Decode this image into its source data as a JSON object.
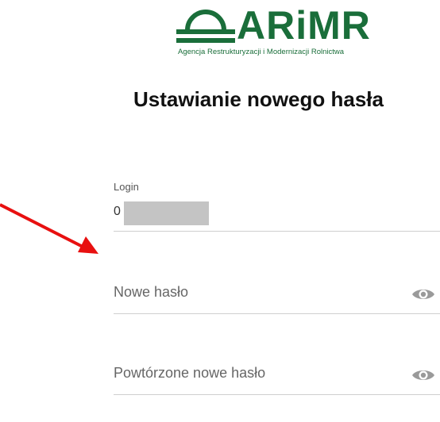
{
  "logo": {
    "name": "ARiMR",
    "subtitle": "Agencja Restrukturyzacji i Modernizacji Rolnictwa",
    "color": "#1a6e3a"
  },
  "page_title": "Ustawianie nowego hasła",
  "login": {
    "label": "Login",
    "value_visible": "0"
  },
  "new_password": {
    "placeholder": "Nowe hasło",
    "icon": "eye-icon"
  },
  "repeat_password": {
    "placeholder": "Powtórzone nowe hasło",
    "icon": "eye-icon"
  },
  "annotation": {
    "arrow_color": "#e81010"
  }
}
